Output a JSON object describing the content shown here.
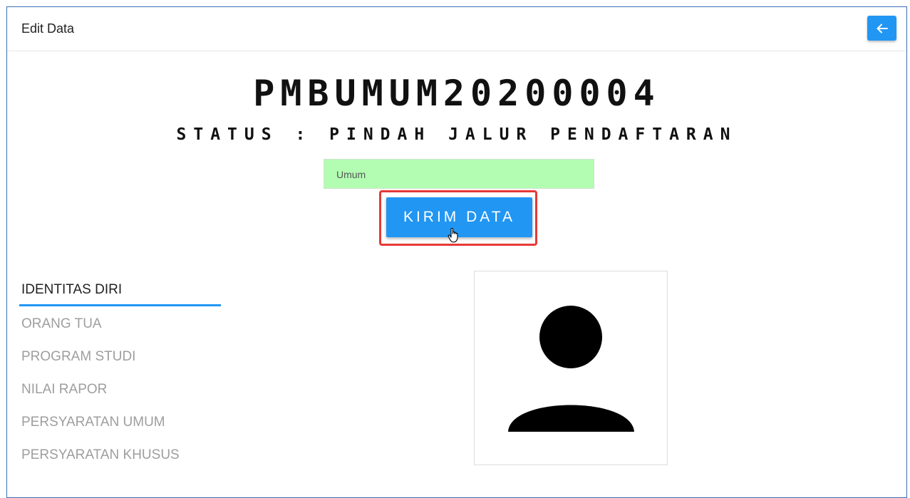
{
  "header": {
    "title": "Edit Data",
    "back_icon": "arrow-left-icon"
  },
  "registration": {
    "code": "PMBUMUM20200004",
    "status": "STATUS : PINDAH JALUR PENDAFTARAN"
  },
  "route": {
    "value": "Umum"
  },
  "submit": {
    "label": "KIRIM DATA"
  },
  "tabs": [
    {
      "label": "IDENTITAS DIRI",
      "active": true
    },
    {
      "label": "ORANG TUA",
      "active": false
    },
    {
      "label": "PROGRAM STUDI",
      "active": false
    },
    {
      "label": "NILAI RAPOR",
      "active": false
    },
    {
      "label": "PERSYARATAN UMUM",
      "active": false
    },
    {
      "label": "PERSYARATAN KHUSUS",
      "active": false
    }
  ],
  "photo": {
    "icon": "user-avatar-icon"
  },
  "colors": {
    "primary": "#2196f3",
    "route_bg": "#b2fdb2",
    "highlight": "#e53935",
    "frame_border": "#3b6fb6"
  }
}
